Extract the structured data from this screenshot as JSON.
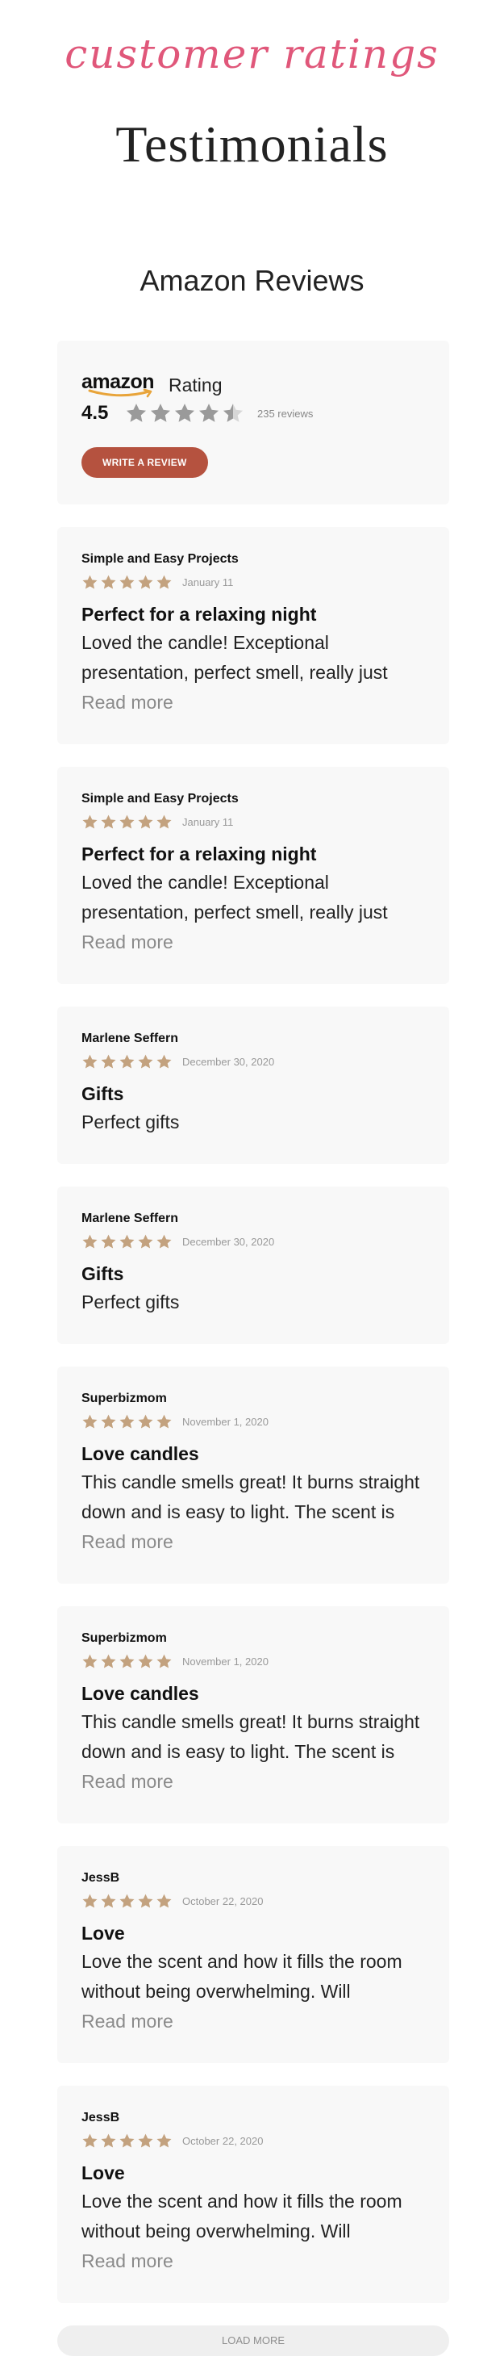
{
  "header": {
    "script_heading": "customer ratings",
    "title": "Testimonials"
  },
  "amazon_section": {
    "title": "Amazon Reviews",
    "summary": {
      "brand": "amazon",
      "rating_label": "Rating",
      "score": "4.5",
      "stars": 4.5,
      "review_count": "235 reviews",
      "write_button": "WRITE A REVIEW"
    },
    "reviews": [
      {
        "author": "Simple and Easy Projects",
        "stars": 5,
        "date": "January 11",
        "title": "Perfect for a relaxing night",
        "body": [
          "Loved the candle! Exceptional",
          "presentation, perfect smell, really just"
        ],
        "read_more": "Read more"
      },
      {
        "author": "Simple and Easy Projects",
        "stars": 5,
        "date": "January 11",
        "title": "Perfect for a relaxing night",
        "body": [
          "Loved the candle! Exceptional",
          "presentation, perfect smell, really just"
        ],
        "read_more": "Read more"
      },
      {
        "author": "Marlene Seffern",
        "stars": 5,
        "date": "December 30, 2020",
        "title": "Gifts",
        "body": [
          "Perfect gifts"
        ],
        "read_more": ""
      },
      {
        "author": "Marlene Seffern",
        "stars": 5,
        "date": "December 30, 2020",
        "title": "Gifts",
        "body": [
          "Perfect gifts"
        ],
        "read_more": ""
      },
      {
        "author": "Superbizmom",
        "stars": 5,
        "date": "November 1, 2020",
        "title": "Love candles",
        "body": [
          "This candle smells great! It burns straight",
          "down and is easy to light. The scent is"
        ],
        "read_more": "Read more"
      },
      {
        "author": "Superbizmom",
        "stars": 5,
        "date": "November 1, 2020",
        "title": "Love candles",
        "body": [
          "This candle smells great! It burns straight",
          "down and is easy to light. The scent is"
        ],
        "read_more": "Read more"
      },
      {
        "author": "JessB",
        "stars": 5,
        "date": "October 22, 2020",
        "title": "Love",
        "body": [
          "Love the scent and how it fills the room",
          "without being overwhelming. Will"
        ],
        "read_more": "Read more"
      },
      {
        "author": "JessB",
        "stars": 5,
        "date": "October 22, 2020",
        "title": "Love",
        "body": [
          "Love the scent and how it fills the room",
          "without being overwhelming. Will"
        ],
        "read_more": "Read more"
      }
    ],
    "load_more": "LOAD MORE"
  },
  "colors": {
    "accent_pink": "#e0577a",
    "button_red": "#b5523f",
    "star_gold": "#c3a27f",
    "star_grey": "#9a9a9a",
    "card_bg": "#f8f8f8"
  }
}
